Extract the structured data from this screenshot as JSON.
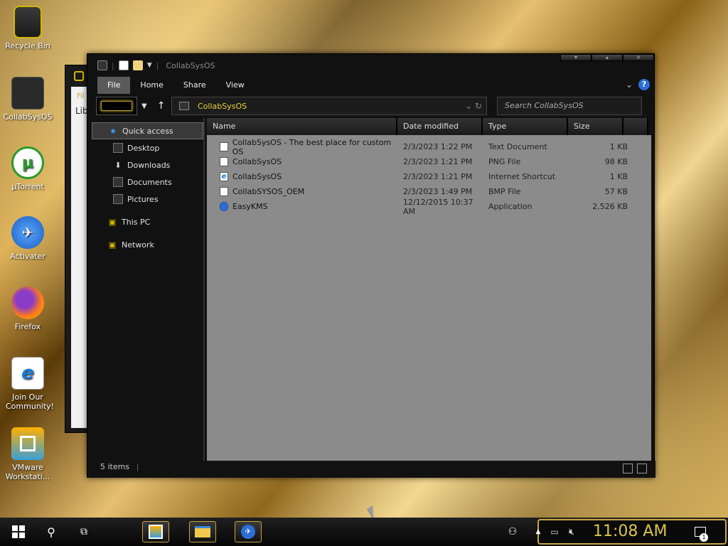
{
  "desktop": {
    "icons": [
      {
        "label": "Recycle Bin"
      },
      {
        "label": "CollabSysOS"
      },
      {
        "label": "µTorrent"
      },
      {
        "label": "Activater"
      },
      {
        "label": "Firefox"
      },
      {
        "label": "Join Our Community!"
      },
      {
        "label": "VMware Workstati..."
      }
    ]
  },
  "background_window": {
    "fragments": [
      "Fil",
      "Lib"
    ]
  },
  "window": {
    "title": "CollabSysOS",
    "ribbon_tabs": [
      "File",
      "Home",
      "Share",
      "View"
    ],
    "active_tab": "File",
    "address_path": "CollabSysOS",
    "search_placeholder": "Search CollabSysOS",
    "nav": {
      "quick_access": "Quick access",
      "desktop": "Desktop",
      "downloads": "Downloads",
      "documents": "Documents",
      "pictures": "Pictures",
      "this_pc": "This PC",
      "network": "Network"
    },
    "columns": {
      "name": "Name",
      "date": "Date modified",
      "type": "Type",
      "size": "Size"
    },
    "files": [
      {
        "name": "CollabSysOS - The best place for custom OS",
        "date": "2/3/2023 1:22 PM",
        "type": "Text Document",
        "size": "1 KB",
        "icon": "text-file-icon"
      },
      {
        "name": "CollabSysOS",
        "date": "2/3/2023 1:21 PM",
        "type": "PNG File",
        "size": "98 KB",
        "icon": "image-file-icon"
      },
      {
        "name": "CollabSysOS",
        "date": "2/3/2023 1:21 PM",
        "type": "Internet Shortcut",
        "size": "1 KB",
        "icon": "ie-shortcut-icon"
      },
      {
        "name": "CollabSYSOS_OEM",
        "date": "2/3/2023 1:49 PM",
        "type": "BMP File",
        "size": "57 KB",
        "icon": "image-file-icon"
      },
      {
        "name": "EasyKMS",
        "date": "12/12/2015 10:37 AM",
        "type": "Application",
        "size": "2,526 KB",
        "icon": "easykms-icon"
      }
    ],
    "status": "5 items"
  },
  "taskbar": {
    "clock": "11:08 AM",
    "notification_count": "1"
  },
  "colors": {
    "accent_gold": "#c9a640",
    "path_yellow": "#ecd13a",
    "clock_yellow": "#d9c64a",
    "help_blue": "#2b6fd6"
  }
}
